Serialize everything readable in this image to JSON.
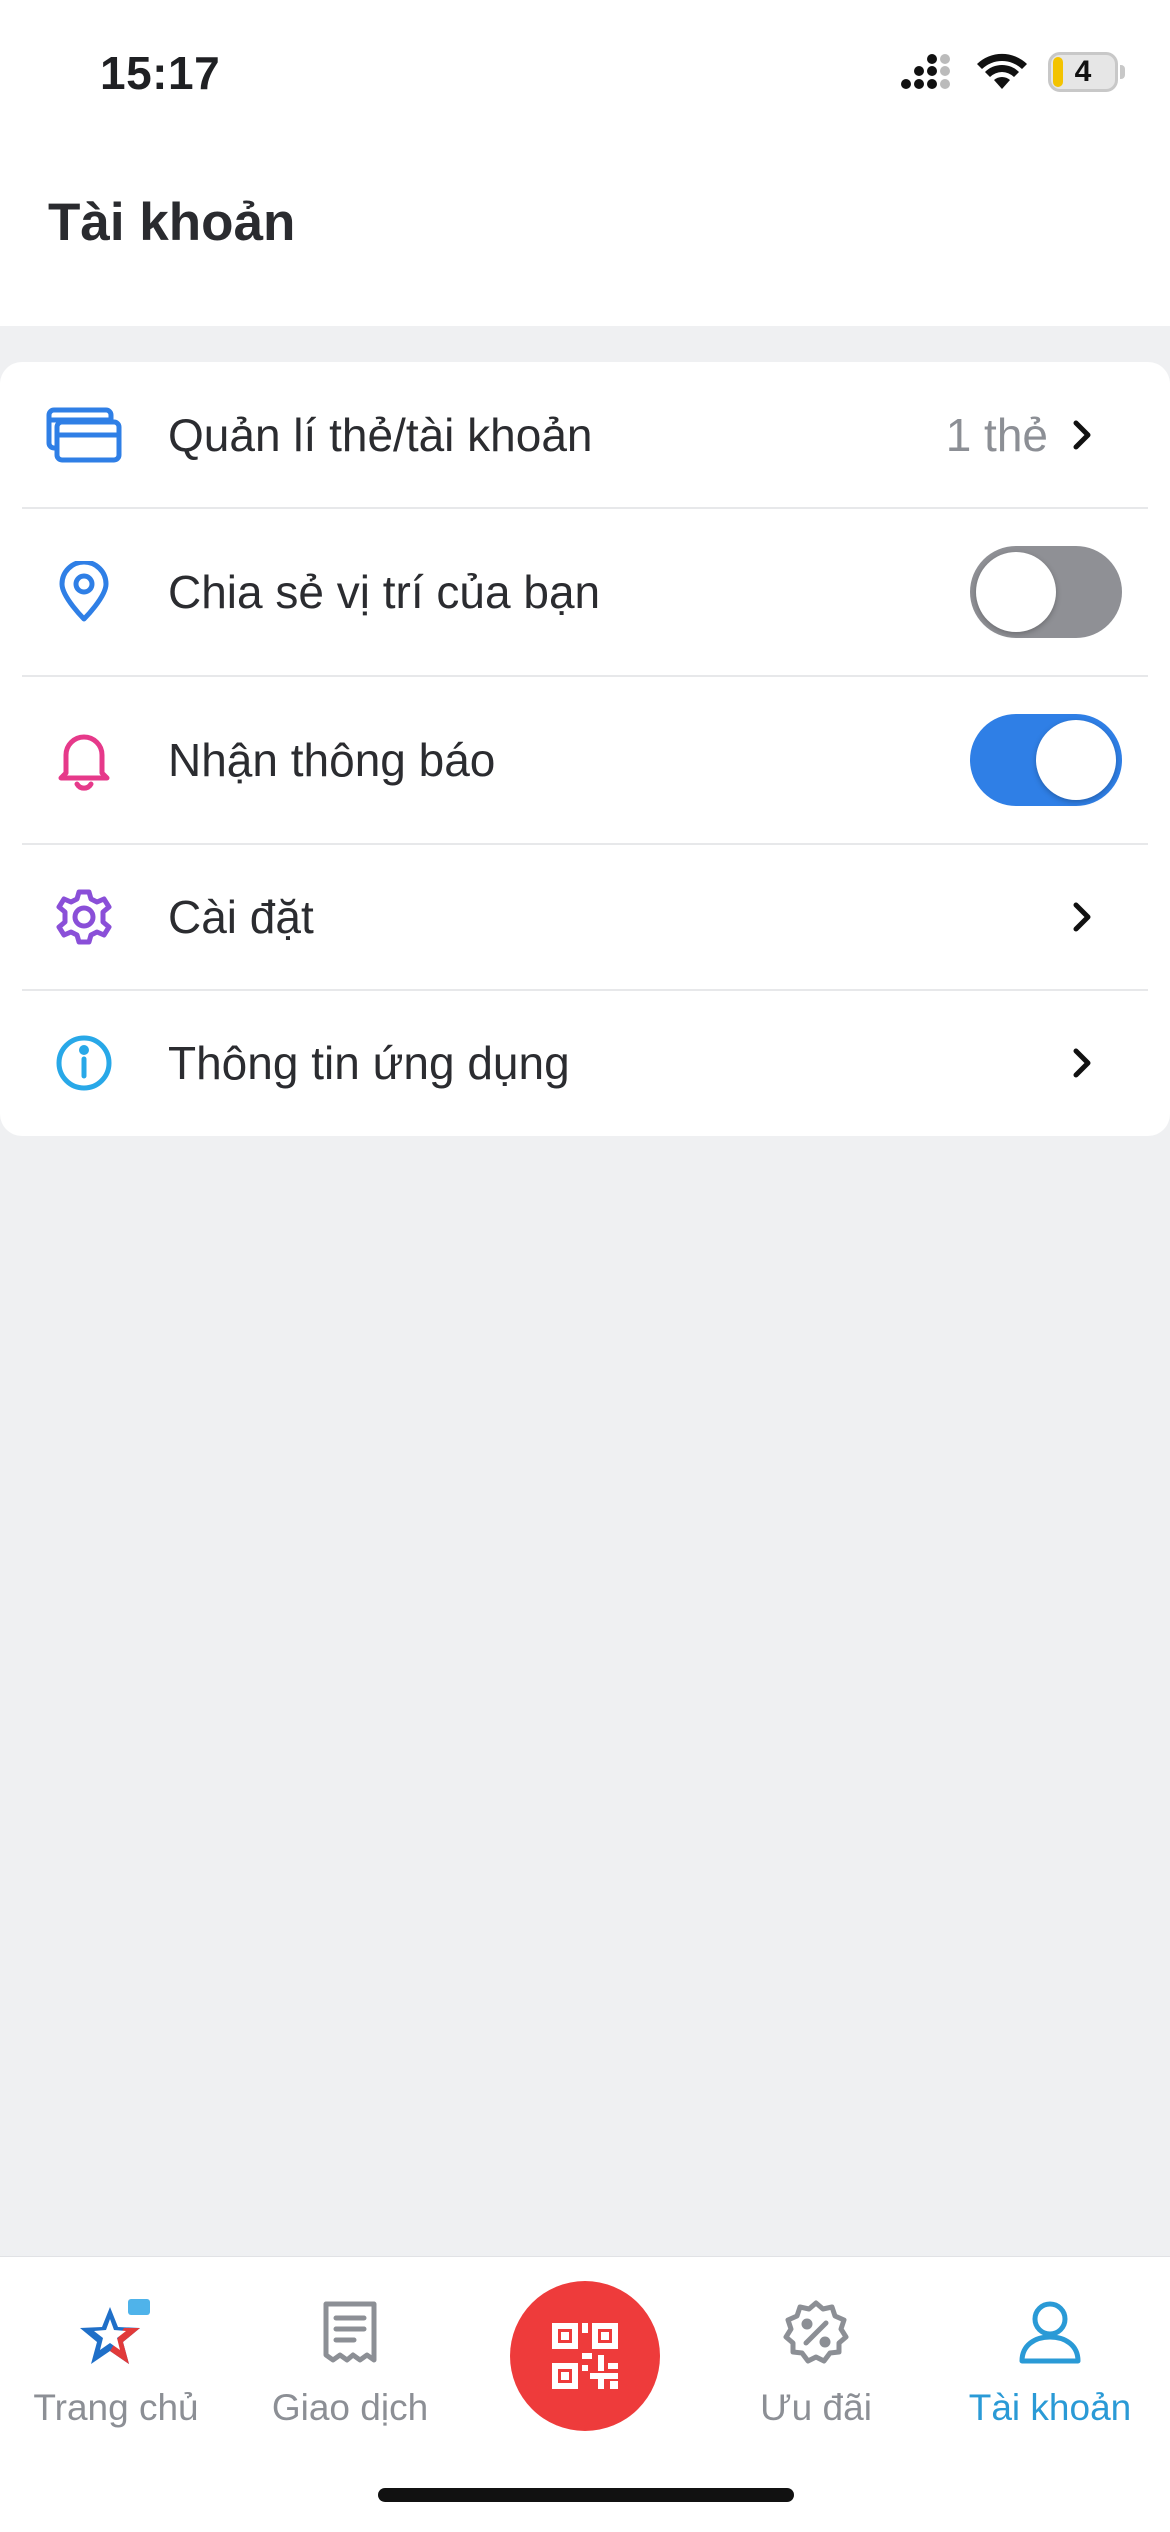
{
  "status_bar": {
    "time": "15:17",
    "battery": "4"
  },
  "header": {
    "title": "Tài khoản"
  },
  "menu": {
    "items": [
      {
        "label": "Quản lí thẻ/tài khoản",
        "value": "1 thẻ",
        "icon": "card-icon"
      },
      {
        "label": "Chia sẻ vị trí của bạn",
        "toggle": false,
        "icon": "location-pin-icon"
      },
      {
        "label": "Nhận thông báo",
        "toggle": true,
        "icon": "bell-icon"
      },
      {
        "label": "Cài đặt",
        "icon": "gear-icon"
      },
      {
        "label": "Thông tin ứng dụng",
        "icon": "info-icon"
      }
    ]
  },
  "bottom_nav": {
    "items": [
      {
        "label": "Trang chủ",
        "icon": "home-star-icon"
      },
      {
        "label": "Giao dịch",
        "icon": "receipt-icon"
      },
      {
        "label": "",
        "icon": "qr-code-icon"
      },
      {
        "label": "Ưu đãi",
        "icon": "discount-badge-icon"
      },
      {
        "label": "Tài khoản",
        "icon": "user-icon",
        "active": true
      }
    ]
  },
  "colors": {
    "accent_blue": "#2f7fe6",
    "nav_active": "#2a9ad6",
    "qr_red": "#ee3b3b",
    "bell_pink": "#e6398a",
    "gear_purple": "#8a4fd8",
    "info_cyan": "#28a8e8"
  }
}
